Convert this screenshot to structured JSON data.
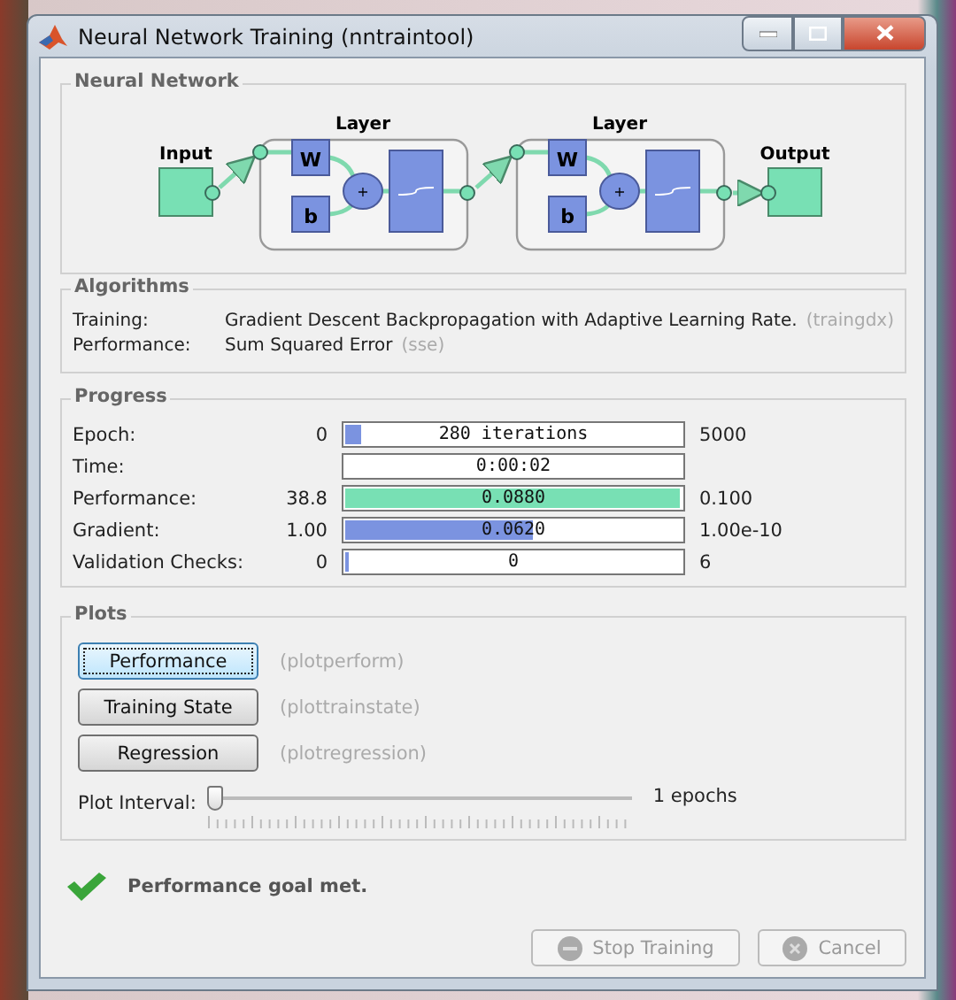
{
  "window": {
    "title": "Neural Network Training (nntraintool)"
  },
  "neural_network": {
    "title": "Neural Network",
    "input_label": "Input",
    "output_label": "Output",
    "layers": [
      {
        "title": "Layer",
        "weight": "W",
        "bias": "b",
        "sum": "+"
      },
      {
        "title": "Layer",
        "weight": "W",
        "bias": "b",
        "sum": "+"
      }
    ]
  },
  "algorithms": {
    "title": "Algorithms",
    "rows": [
      {
        "label": "Training:",
        "value": "Gradient Descent Backpropagation with Adaptive Learning Rate.",
        "code": "(traingdx)"
      },
      {
        "label": "Performance:",
        "value": "Sum Squared Error",
        "code": "(sse)"
      }
    ]
  },
  "progress": {
    "title": "Progress",
    "rows": [
      {
        "label": "Epoch:",
        "start": "0",
        "level": 0.056,
        "kind": "blue",
        "reading": "280 iterations",
        "end": "5000"
      },
      {
        "label": "Time:",
        "reading": "0:00:02"
      },
      {
        "label": "Performance:",
        "start": "38.8",
        "level": 0.995,
        "kind": "green",
        "reading": "0.0880",
        "end": "0.100"
      },
      {
        "label": "Gradient:",
        "start": "1.00",
        "level": 0.56,
        "kind": "blue",
        "reading": "0.0620",
        "end": "1.00e-10"
      },
      {
        "label": "Validation Checks:",
        "start": "0",
        "level": 0.005,
        "kind": "blue",
        "reading": "0",
        "end": "6"
      }
    ]
  },
  "plots": {
    "title": "Plots",
    "buttons": [
      {
        "label": "Performance",
        "code": "(plotperform)",
        "focused": true
      },
      {
        "label": "Training State",
        "code": "(plottrainstate)",
        "focused": false
      },
      {
        "label": "Regression",
        "code": "(plotregression)",
        "focused": false
      }
    ],
    "interval": {
      "label": "Plot Interval:",
      "level": 0,
      "reading": "1 epochs"
    }
  },
  "status": {
    "message": "Performance goal met."
  },
  "buttons": [
    {
      "label": "Stop Training",
      "kind": "stop",
      "disabled": true
    },
    {
      "label": "Cancel",
      "kind": "cancel",
      "disabled": true
    }
  ]
}
